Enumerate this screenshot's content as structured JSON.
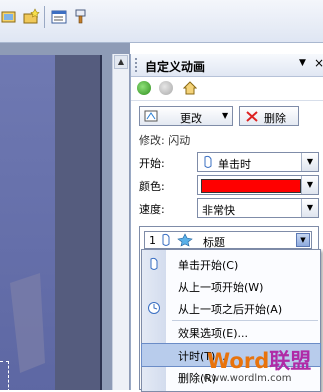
{
  "task_pane": {
    "title": "自定义动画",
    "change_button": "更改",
    "delete_button": "删除",
    "modify_label": "修改: 闪动",
    "start_label": "开始:",
    "start_value": "单击时",
    "color_label": "颜色:",
    "color_value": "#ff0000",
    "speed_label": "速度:",
    "speed_value": "非常快",
    "effect_item": {
      "number": "1",
      "name": "标题"
    }
  },
  "context_menu": {
    "items": [
      {
        "label": "单击开始(C)",
        "icon": "mouse-click-icon"
      },
      {
        "label": "从上一项开始(W)",
        "icon": ""
      },
      {
        "label": "从上一项之后开始(A)",
        "icon": "clock-icon"
      },
      {
        "label": "效果选项(E)...",
        "icon": ""
      },
      {
        "label": "计时(T)...",
        "icon": ""
      },
      {
        "label": "删除(R)",
        "icon": ""
      }
    ]
  },
  "watermark": {
    "logo_word": "Word",
    "logo_cn": "联盟",
    "url": "www.wordlm.com"
  },
  "colors": {
    "accent_red": "#ff0000",
    "menu_highlight": "#b8ccec",
    "watermark_orange": "#e8730c",
    "watermark_purple": "#b02aa6"
  }
}
